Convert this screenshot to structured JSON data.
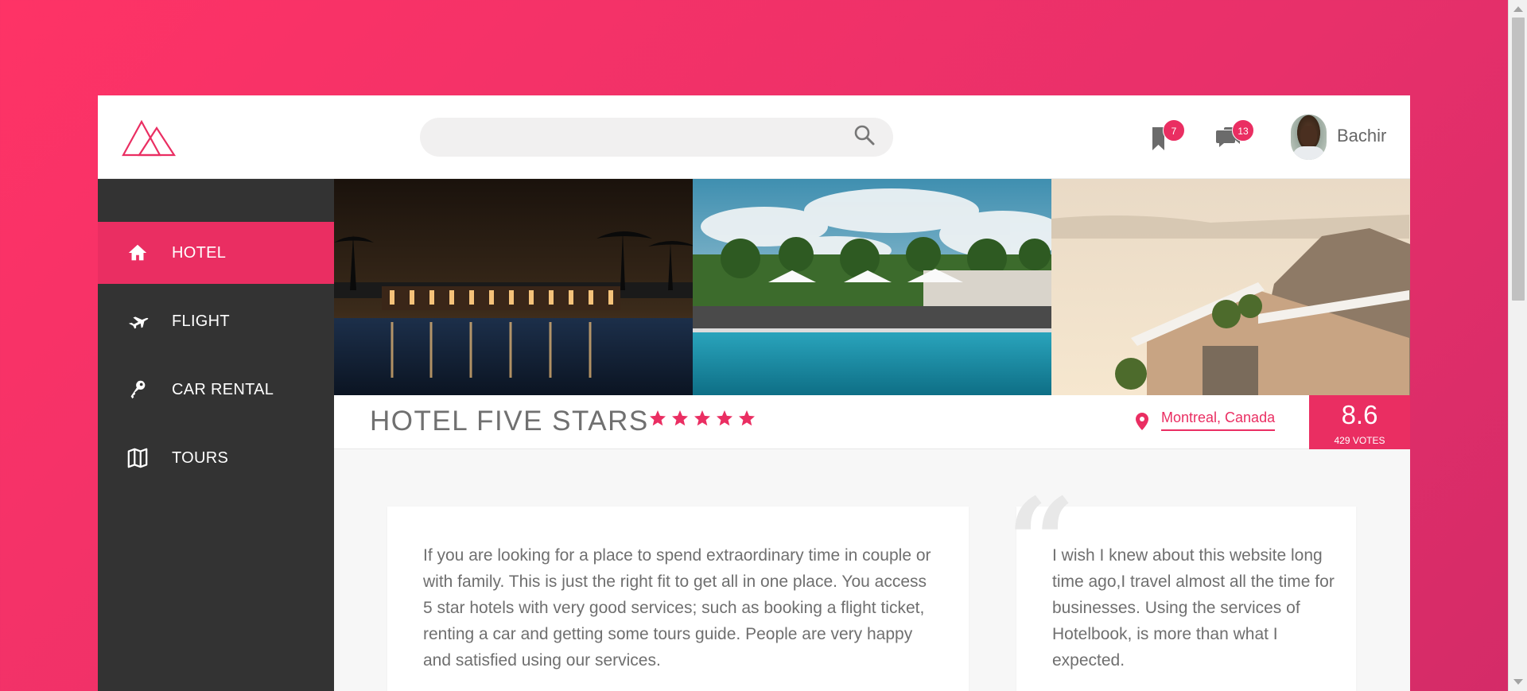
{
  "header": {
    "search_placeholder": "",
    "bookmarks_badge": "7",
    "messages_badge": "13",
    "username": "Bachir"
  },
  "sidebar": {
    "items": [
      {
        "label": "HOTEL",
        "icon": "home-icon",
        "active": true
      },
      {
        "label": "FLIGHT",
        "icon": "airplane-icon",
        "active": false
      },
      {
        "label": "CAR RENTAL",
        "icon": "key-icon",
        "active": false
      },
      {
        "label": "TOURS",
        "icon": "map-icon",
        "active": false
      }
    ]
  },
  "hotel": {
    "title": "HOTEL FIVE STARS",
    "stars": 5,
    "location": "Montreal, Canada",
    "score": "8.6",
    "votes": "429 VOTES"
  },
  "content": {
    "description": "If you are looking for a place to spend extraordinary time in couple or with family. This is just the right fit to get all in one place. You access 5 star hotels with very good services; such as booking a flight ticket, renting a car and getting some tours guide. People are very happy and satisfied using our services.",
    "review": "I wish I knew about this website long time ago,I travel almost all the time for businesses. Using the services of Hotelbook, is more than what I expected.",
    "quote_glyph": "“"
  },
  "colors": {
    "accent": "#ea2e62",
    "sidebar_bg": "#333333",
    "background_gradient_start": "#fe3366",
    "background_gradient_end": "#d42b68"
  }
}
